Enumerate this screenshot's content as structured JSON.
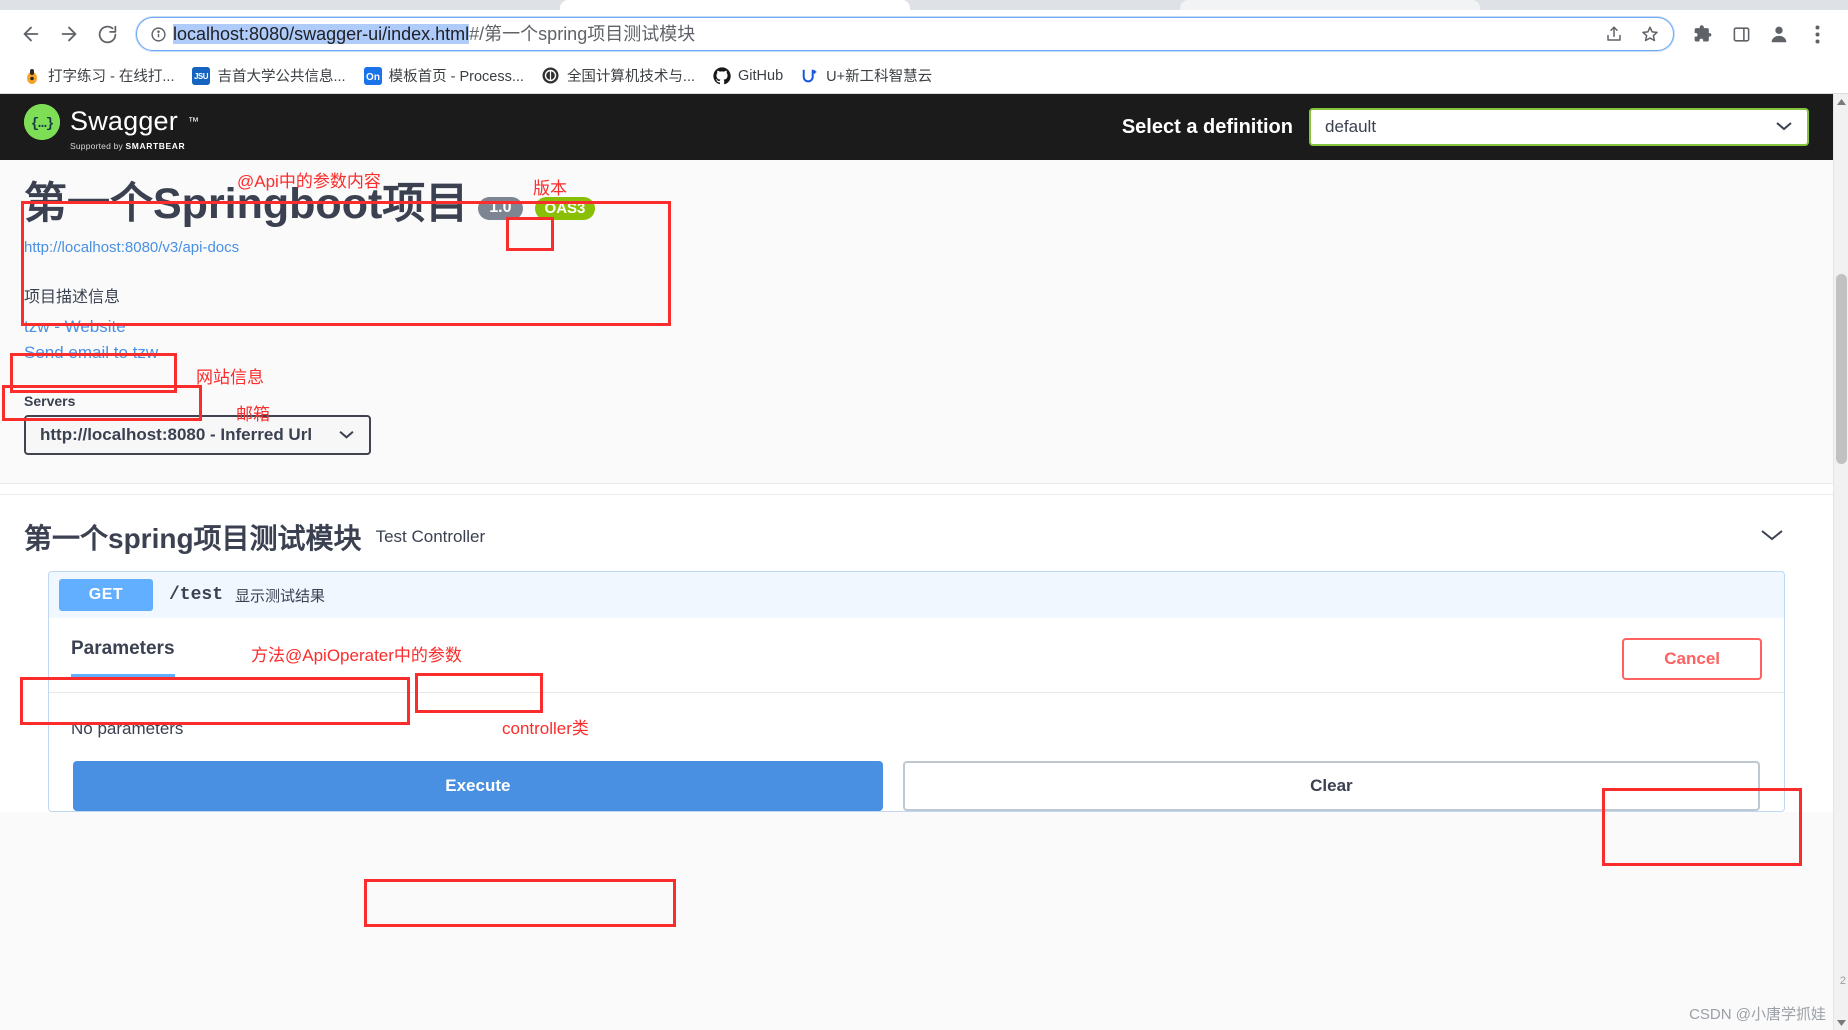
{
  "browser": {
    "back_label": "Back",
    "forward_label": "Forward",
    "reload_label": "Reload",
    "url_selected": "localhost:8080/swagger-ui/index.html",
    "url_rest": "#/第一个spring项目测试模块",
    "share_label": "Share this page",
    "bookmark_label": "Bookmark this tab",
    "extensions_label": "Extensions",
    "sidepanel_label": "Side panel",
    "profile_label": "Profile",
    "menu_label": "Customize and control Chrome",
    "bookmarks": [
      {
        "label": "打字练习 - 在线打...",
        "icon": "typing-icon",
        "glyph": "⌨"
      },
      {
        "label": "吉首大学公共信息...",
        "icon": "university-icon",
        "glyph": "JSU"
      },
      {
        "label": "模板首页 - Process...",
        "icon": "on-icon",
        "glyph": "On"
      },
      {
        "label": "全国计算机技术与...",
        "icon": "ncre-icon",
        "glyph": "◎"
      },
      {
        "label": "GitHub",
        "icon": "github-icon",
        "glyph": ""
      },
      {
        "label": "U+新工科智慧云",
        "icon": "uplus-icon",
        "glyph": "U+"
      }
    ]
  },
  "swagger": {
    "logo_text": "Swagger",
    "logo_mark": "{...}",
    "logo_trademark": "™",
    "supported_by_prefix": "Supported by ",
    "supported_by_brand": "SMARTBEAR",
    "definition_label": "Select a definition",
    "definition_value": "default",
    "definition_options": [
      "default"
    ]
  },
  "info": {
    "title": "第一个Springboot项目",
    "version_badge": "1.0",
    "oas_badge": "OAS3",
    "api_docs_url": "http://localhost:8080/v3/api-docs",
    "description": "项目描述信息",
    "website_link": "tzw - Website",
    "email_link": "Send email to tzw"
  },
  "servers": {
    "label": "Servers",
    "selected": "http://localhost:8080 - Inferred Url",
    "options": [
      "http://localhost:8080 - Inferred Url"
    ]
  },
  "tag": {
    "name": "第一个spring项目测试模块",
    "description": "Test Controller",
    "expanded": true
  },
  "operation": {
    "method": "GET",
    "path": "/test",
    "summary": "显示测试结果",
    "parameters_tab": "Parameters",
    "cancel_button": "Cancel",
    "no_parameters": "No parameters",
    "execute_button": "Execute",
    "clear_button": "Clear"
  },
  "annotations": [
    {
      "id": "api-params",
      "text": "@Api中的参数内容"
    },
    {
      "id": "version",
      "text": "版本"
    },
    {
      "id": "website",
      "text": "网站信息"
    },
    {
      "id": "email",
      "text": "邮箱"
    },
    {
      "id": "apioperater",
      "text": "方法@ApiOperater中的参数"
    },
    {
      "id": "controller",
      "text": "controller类"
    }
  ],
  "watermark": "CSDN @小唐学抓娃",
  "colors": {
    "swagger_green": "#89bf04",
    "logo_green": "#7ede56",
    "get_blue": "#61affe",
    "link_blue": "#4990e2",
    "annotation_red": "#fb2c2c",
    "cancel_red": "#ff6060",
    "topbar_dark": "#1b1b1b"
  },
  "edge_marker": "2"
}
